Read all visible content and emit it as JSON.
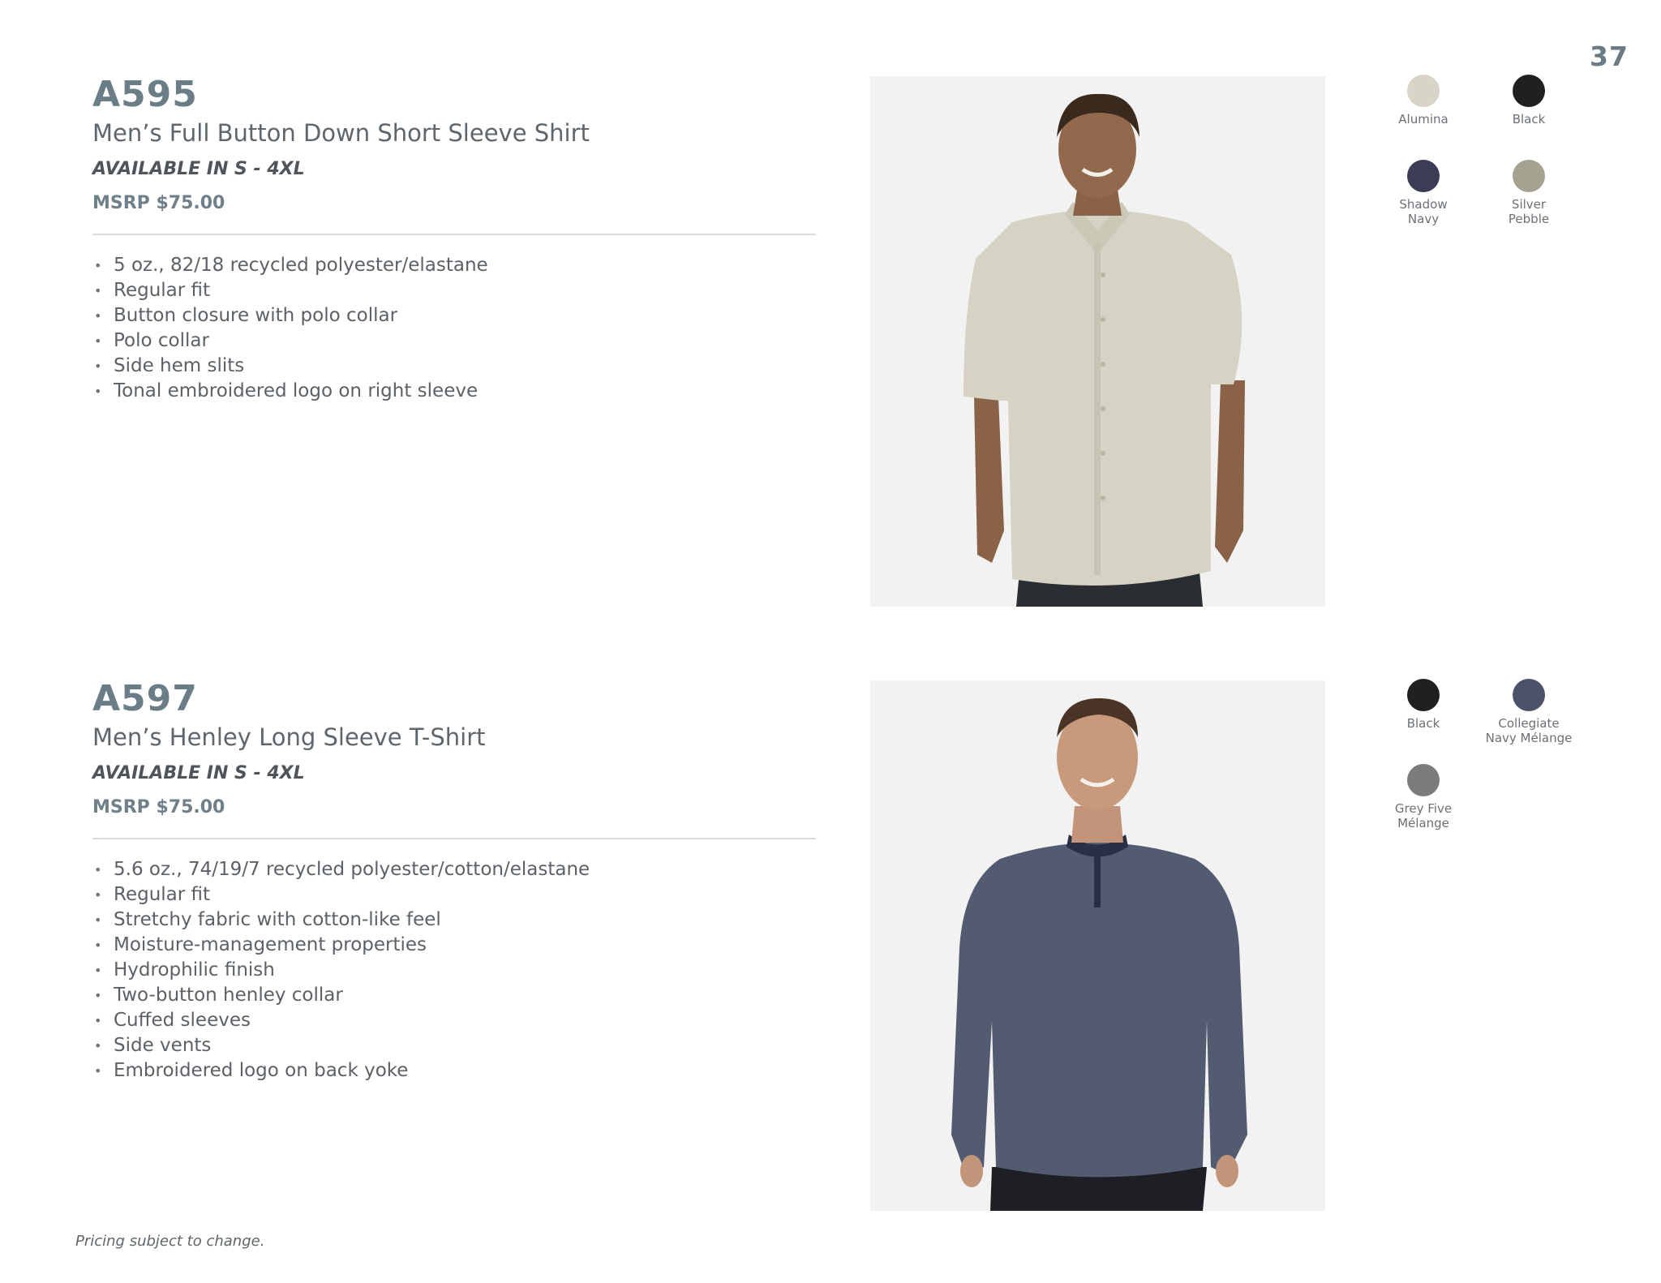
{
  "page_number": "37",
  "products": [
    {
      "code": "A595",
      "name": "Men’s Full Button Down Short Sleeve Shirt",
      "availability": "AVAILABLE IN S - 4XL",
      "msrp": "MSRP $75.00",
      "features": [
        "5 oz., 82/18 recycled polyester/elastane",
        "Regular fit",
        "Button closure with polo collar",
        "Polo collar",
        "Side hem slits",
        "Tonal embroidered logo on right sleeve"
      ],
      "colors": [
        {
          "name": "Alumina",
          "hex": "#d8d4c8"
        },
        {
          "name": "Black",
          "hex": "#1f2021"
        },
        {
          "name": "Shadow Navy",
          "hex": "#3a3d54"
        },
        {
          "name": "Silver Pebble",
          "hex": "#a6a291"
        }
      ]
    },
    {
      "code": "A597",
      "name": "Men’s Henley Long Sleeve T-Shirt",
      "availability": "AVAILABLE IN S - 4XL",
      "msrp": "MSRP $75.00",
      "features": [
        "5.6 oz., 74/19/7 recycled polyester/cotton/elastane",
        "Regular fit",
        "Stretchy fabric with cotton-like feel",
        "Moisture-management properties",
        "Hydrophilic finish",
        "Two-button henley collar",
        "Cuffed sleeves",
        "Side vents",
        "Embroidered logo on back yoke"
      ],
      "colors": [
        {
          "name": "Black",
          "hex": "#1f2021"
        },
        {
          "name": "Collegiate Navy Mélange",
          "hex": "#4c5268"
        },
        {
          "name": "Grey Five Mélange",
          "hex": "#7b7b7d"
        }
      ]
    }
  ],
  "footer_note": "Pricing subject to change."
}
